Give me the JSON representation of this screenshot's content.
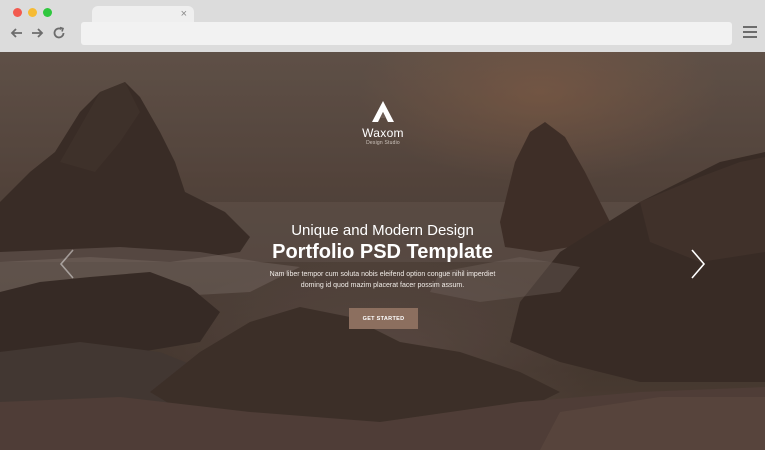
{
  "browser": {
    "tab_close": "×"
  },
  "hero": {
    "logo_name": "Waxom",
    "logo_sub": "Design Studio",
    "subtitle": "Unique and Modern Design",
    "title": "Portfolio PSD Template",
    "desc_line1": "Nam liber tempor cum soluta nobis eleifend option congue nihil imperdiet",
    "desc_line2": "doming id quod mazim placerat facer possim assum.",
    "cta_label": "GET STARTED"
  },
  "colors": {
    "accent": "#8c6f5f",
    "traffic_red": "#f25a4f",
    "traffic_yellow": "#f6bb34",
    "traffic_green": "#2fc73e"
  }
}
